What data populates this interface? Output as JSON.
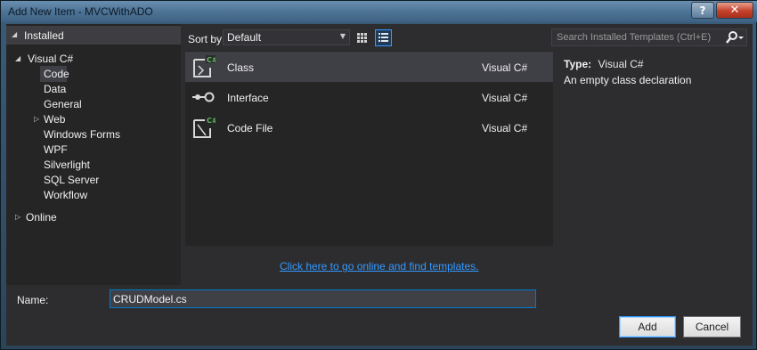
{
  "window": {
    "title": "Add New Item - MVCWithADO",
    "help_label": "?",
    "close_label": "✕"
  },
  "tree": {
    "installed": "Installed",
    "visual_csharp": "Visual C#",
    "items": [
      "Code",
      "Data",
      "General",
      "Web",
      "Windows Forms",
      "WPF",
      "Silverlight",
      "SQL Server",
      "Workflow"
    ],
    "online": "Online",
    "selected": "Code"
  },
  "toolbar": {
    "sort_label": "Sort by:",
    "sort_value": "Default"
  },
  "templates": [
    {
      "name": "Class",
      "lang": "Visual C#",
      "icon": "class-icon"
    },
    {
      "name": "Interface",
      "lang": "Visual C#",
      "icon": "interface-icon"
    },
    {
      "name": "Code File",
      "lang": "Visual C#",
      "icon": "code-file-icon"
    }
  ],
  "online_link": "Click here to go online and find templates.",
  "search": {
    "placeholder": "Search Installed Templates (Ctrl+E)"
  },
  "details": {
    "type_label": "Type:",
    "type_value": "Visual C#",
    "description": "An empty class declaration"
  },
  "name_field": {
    "label": "Name:",
    "value": "CRUDModel.cs"
  },
  "buttons": {
    "add": "Add",
    "cancel": "Cancel"
  },
  "colors": {
    "accent": "#3399ff",
    "csharp_badge": "#5fb75f",
    "background": "#2d2d30"
  }
}
